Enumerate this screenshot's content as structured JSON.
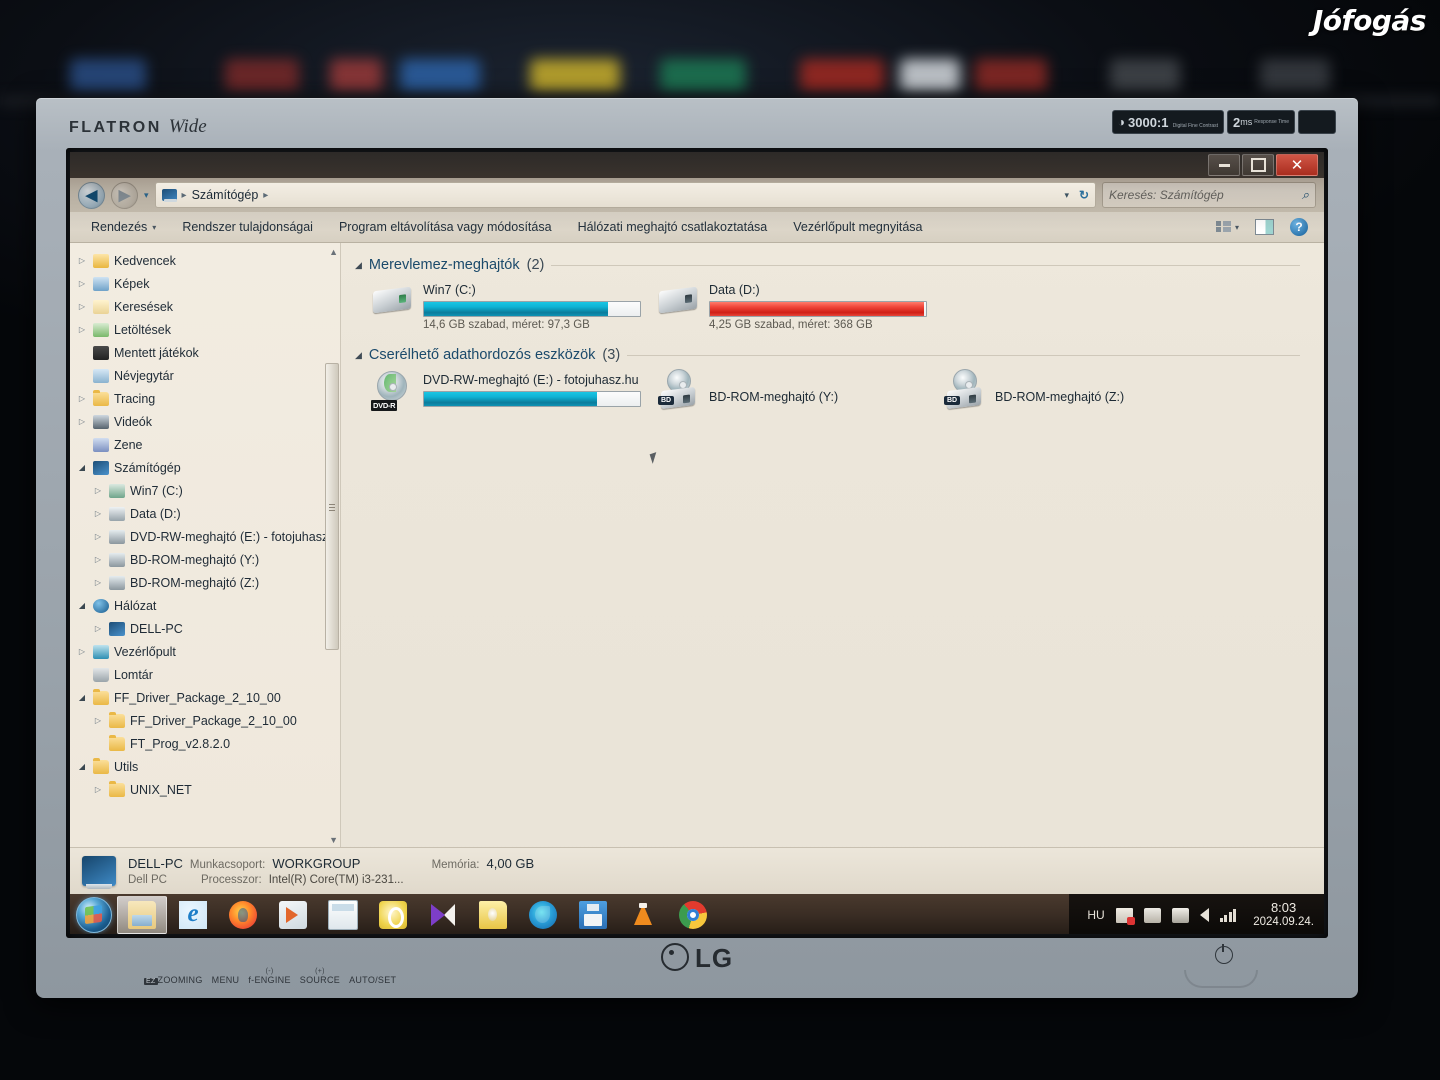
{
  "photo": {
    "watermark": "Jófogás",
    "monitor_brand_line": "FLATRON",
    "monitor_brand_italic": "Wide",
    "badge_contrast": "3000:1",
    "badge_contrast_sub": "Digital Fine Contrast",
    "badge_response": "2",
    "badge_response_unit": "ms",
    "badge_response_sub": "Response Time",
    "lg_logo": "LG",
    "osd_buttons": [
      "EZ",
      "ZOOMING",
      "MENU",
      "f-ENGINE",
      "SOURCE",
      "AUTO/SET"
    ],
    "osd_minus": "(-)",
    "osd_plus": "(+)"
  },
  "window": {
    "controls": {
      "minimize": "—",
      "maximize": "❐",
      "close": "✕"
    },
    "address": {
      "back_glyph": "◀",
      "forward_glyph": "▶",
      "dropdown_glyph": "▾",
      "computer_icon": "computer-icon",
      "crumb": "Számítógép",
      "separator": "▸",
      "refresh_glyph": "↻"
    },
    "search": {
      "placeholder": "Keresés: Számítógép",
      "icon": "search-icon"
    },
    "toolbar": {
      "organize": "Rendezés",
      "organize_caret": "▾",
      "items": [
        "Rendszer tulajdonságai",
        "Program eltávolítása vagy módosítása",
        "Hálózati meghajtó csatlakoztatása",
        "Vezérlőpult megnyitása"
      ],
      "view_caret": "▾",
      "help": "?"
    }
  },
  "nav": {
    "items": [
      {
        "label": "Kedvencek",
        "indent": 0,
        "twisty": "collapsed",
        "icon": "folder-favorites-icon"
      },
      {
        "label": "Képek",
        "indent": 0,
        "twisty": "collapsed",
        "icon": "folder-pictures-icon"
      },
      {
        "label": "Keresések",
        "indent": 0,
        "twisty": "collapsed",
        "icon": "folder-searches-icon"
      },
      {
        "label": "Letöltések",
        "indent": 0,
        "twisty": "collapsed",
        "icon": "folder-downloads-icon"
      },
      {
        "label": "Mentett játékok",
        "indent": 0,
        "twisty": "none",
        "icon": "folder-saved-games-icon"
      },
      {
        "label": "Névjegytár",
        "indent": 0,
        "twisty": "none",
        "icon": "folder-contacts-icon"
      },
      {
        "label": "Tracing",
        "indent": 0,
        "twisty": "collapsed",
        "icon": "folder-icon"
      },
      {
        "label": "Videók",
        "indent": 0,
        "twisty": "collapsed",
        "icon": "folder-videos-icon"
      },
      {
        "label": "Zene",
        "indent": 0,
        "twisty": "none",
        "icon": "folder-music-icon"
      },
      {
        "label": "Számítógép",
        "indent": 0,
        "twisty": "expanded",
        "icon": "computer-icon"
      },
      {
        "label": "Win7 (C:)",
        "indent": 1,
        "twisty": "collapsed",
        "icon": "hard-drive-windows-icon"
      },
      {
        "label": "Data (D:)",
        "indent": 1,
        "twisty": "collapsed",
        "icon": "hard-drive-icon"
      },
      {
        "label": "DVD-RW-meghajtó (E:) - fotojuhasz.",
        "indent": 1,
        "twisty": "collapsed",
        "icon": "optical-drive-icon"
      },
      {
        "label": "BD-ROM-meghajtó (Y:)",
        "indent": 1,
        "twisty": "collapsed",
        "icon": "optical-drive-icon"
      },
      {
        "label": "BD-ROM-meghajtó (Z:)",
        "indent": 1,
        "twisty": "collapsed",
        "icon": "optical-drive-icon"
      },
      {
        "label": "Hálózat",
        "indent": 0,
        "twisty": "expanded",
        "icon": "network-icon"
      },
      {
        "label": "DELL-PC",
        "indent": 1,
        "twisty": "collapsed",
        "icon": "computer-icon"
      },
      {
        "label": "Vezérlőpult",
        "indent": 0,
        "twisty": "collapsed",
        "icon": "control-panel-icon"
      },
      {
        "label": "Lomtár",
        "indent": 0,
        "twisty": "none",
        "icon": "recycle-bin-icon"
      },
      {
        "label": "FF_Driver_Package_2_10_00",
        "indent": 0,
        "twisty": "expanded",
        "icon": "folder-icon"
      },
      {
        "label": "FF_Driver_Package_2_10_00",
        "indent": 1,
        "twisty": "collapsed",
        "icon": "folder-icon"
      },
      {
        "label": "FT_Prog_v2.8.2.0",
        "indent": 1,
        "twisty": "none",
        "icon": "folder-icon"
      },
      {
        "label": "Utils",
        "indent": 0,
        "twisty": "expanded",
        "icon": "folder-icon"
      },
      {
        "label": "UNIX_NET",
        "indent": 1,
        "twisty": "collapsed",
        "icon": "folder-icon"
      }
    ]
  },
  "content": {
    "groups": [
      {
        "title": "Merevlemez-meghajtók",
        "count": "(2)",
        "collapse_glyph": "◢",
        "drives": [
          {
            "name": "Win7 (C:)",
            "info": "14,6 GB szabad, méret: 97,3 GB",
            "used_percent": 85,
            "bar_color": "teal",
            "icon": "hard-drive-windows-icon",
            "kind": "hdd"
          },
          {
            "name": "Data (D:)",
            "info": "4,25 GB szabad, méret: 368 GB",
            "used_percent": 99,
            "bar_color": "red",
            "icon": "hard-drive-icon",
            "kind": "hdd"
          }
        ]
      },
      {
        "title": "Cserélhető adathordozós eszközök",
        "count": "(3)",
        "collapse_glyph": "◢",
        "drives": [
          {
            "name": "DVD-RW-meghajtó (E:) - fotojuhasz.hu",
            "info": "",
            "used_percent": 80,
            "bar_color": "teal",
            "icon": "optical-drive-icon",
            "kind": "dvd",
            "badge": "DVD-R"
          },
          {
            "name": "BD-ROM-meghajtó (Y:)",
            "info": "",
            "used_percent": null,
            "bar_color": "",
            "icon": "optical-drive-icon",
            "kind": "bd",
            "badge": "BD"
          },
          {
            "name": "BD-ROM-meghajtó (Z:)",
            "info": "",
            "used_percent": null,
            "bar_color": "",
            "icon": "optical-drive-icon",
            "kind": "bd",
            "badge": "BD"
          }
        ]
      }
    ]
  },
  "statusbar": {
    "computer_name": "DELL-PC",
    "computer_sub": "Dell PC",
    "workgroup_key": "Munkacsoport:",
    "workgroup_value": "WORKGROUP",
    "processor_key": "Processzor:",
    "processor_value": "Intel(R) Core(TM) i3-231...",
    "memory_key": "Memória:",
    "memory_value": "4,00 GB"
  },
  "taskbar": {
    "start_label": "start-orb",
    "buttons": [
      {
        "name": "windows-explorer",
        "glyph": "g-explorer",
        "active": true
      },
      {
        "name": "internet-explorer",
        "glyph": "g-ie",
        "active": false
      },
      {
        "name": "firefox",
        "glyph": "g-ff",
        "active": false
      },
      {
        "name": "windows-media-player",
        "glyph": "g-wmp",
        "active": false
      },
      {
        "name": "calculator",
        "glyph": "g-calc",
        "active": false
      },
      {
        "name": "office",
        "glyph": "g-off",
        "active": false
      },
      {
        "name": "media-player-classic",
        "glyph": "g-mpc",
        "active": false
      },
      {
        "name": "notepad",
        "glyph": "g-note",
        "active": false
      },
      {
        "name": "microsoft-edge",
        "glyph": "g-edge",
        "active": false
      },
      {
        "name": "save-app",
        "glyph": "g-save",
        "active": false
      },
      {
        "name": "vlc-media-player",
        "glyph": "g-vlc",
        "active": false
      },
      {
        "name": "google-chrome",
        "glyph": "g-chrome",
        "active": false
      }
    ],
    "tray": {
      "language": "HU",
      "icons": [
        "action-center-flag-icon",
        "removable-device-icon",
        "network-icon",
        "volume-icon",
        "signal-icon"
      ],
      "time": "8:03",
      "date": "2024.09.24."
    }
  }
}
